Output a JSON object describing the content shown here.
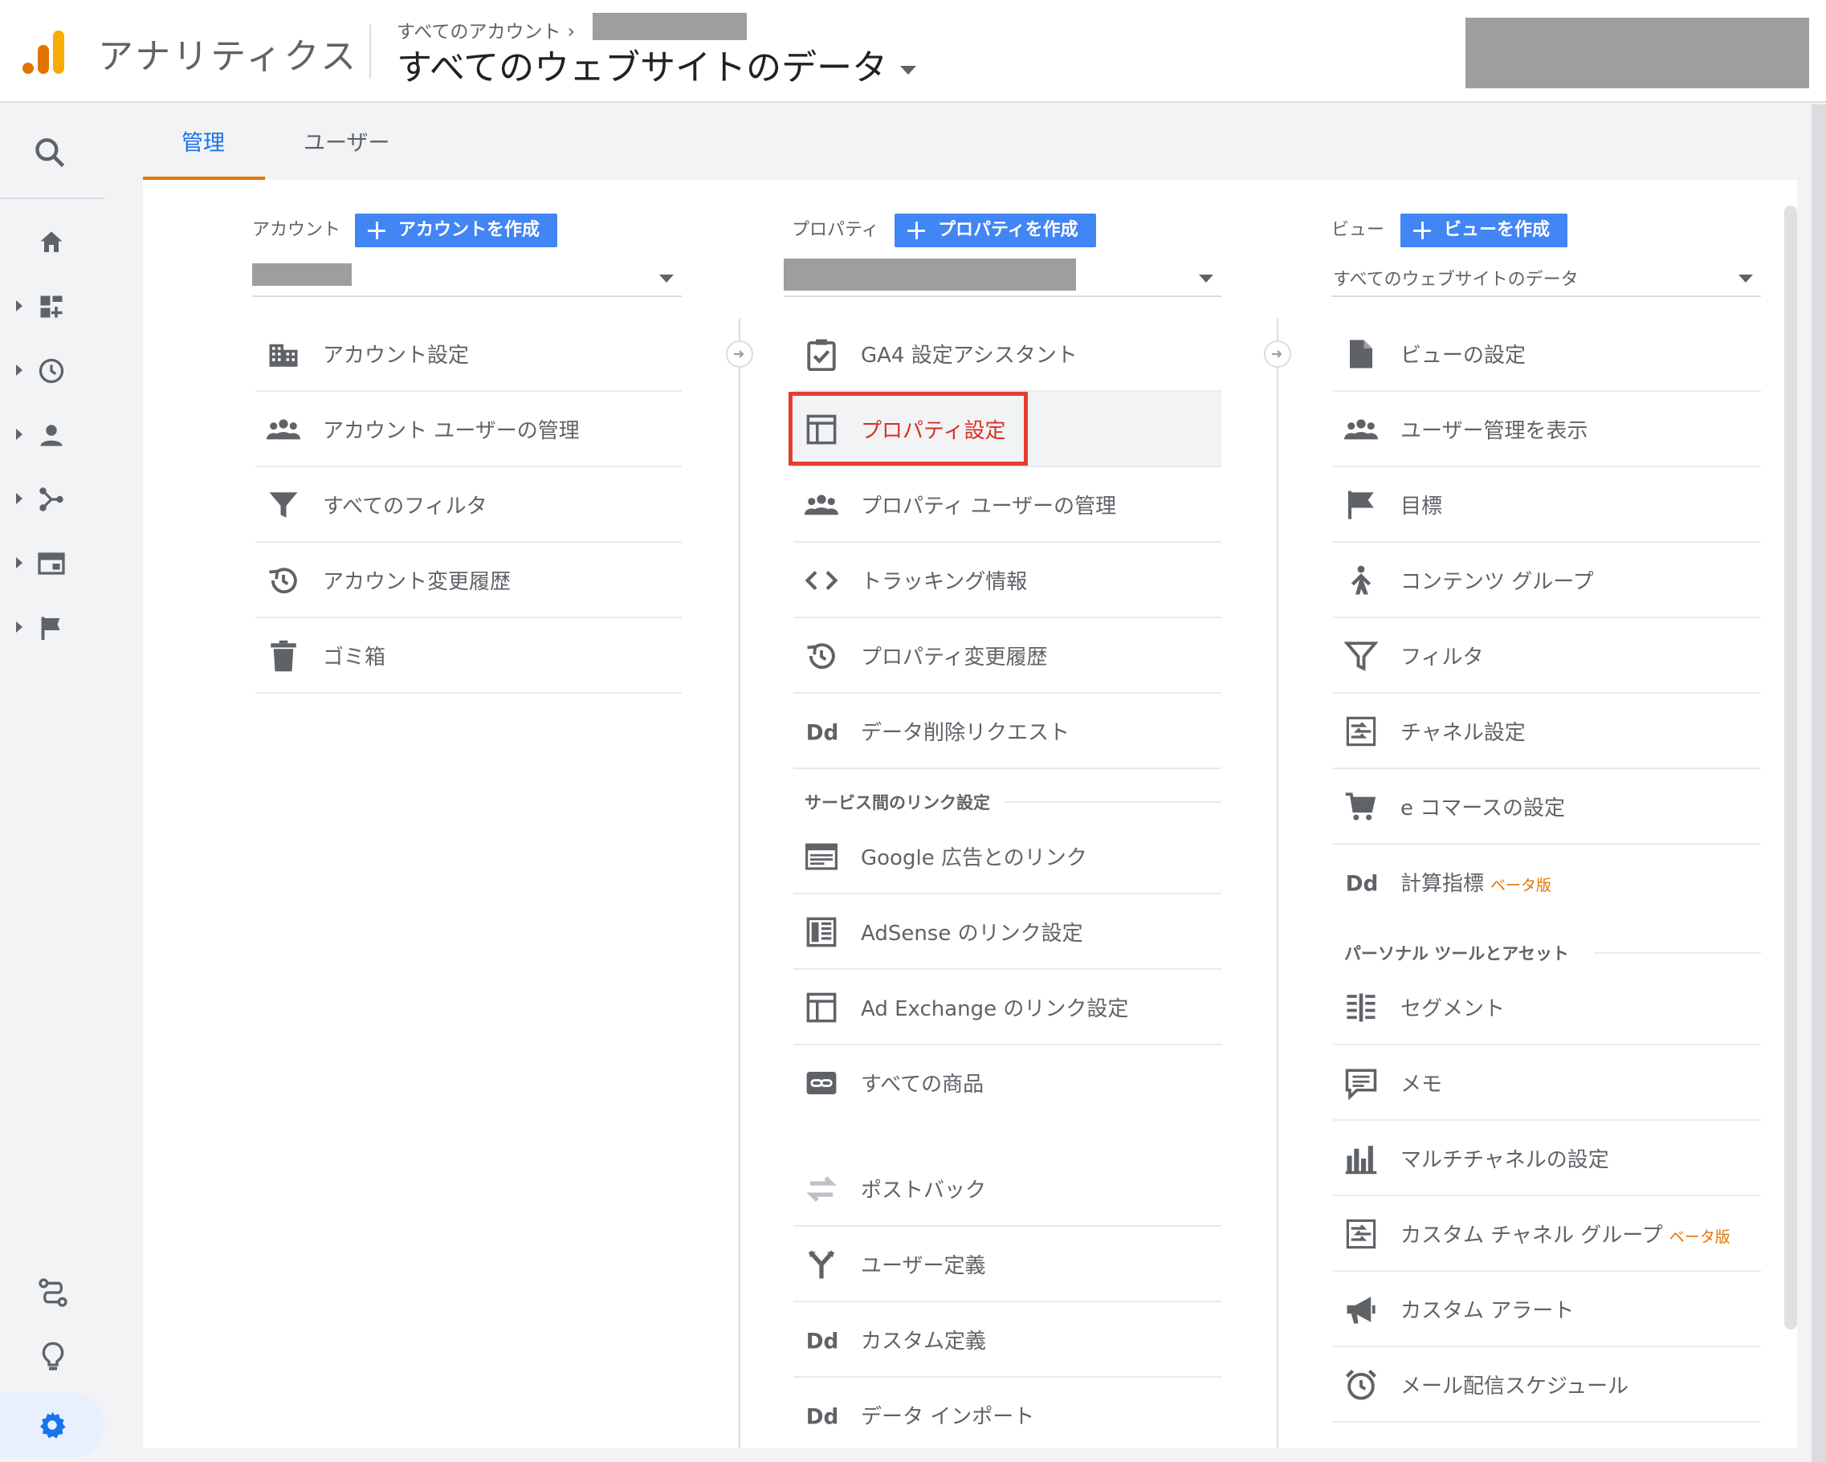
{
  "header": {
    "app_title": "アナリティクス",
    "breadcrumb": "すべてのアカウント",
    "view_title": "すべてのウェブサイトのデータ"
  },
  "tabs": [
    {
      "label": "管理",
      "active": true
    },
    {
      "label": "ユーザー",
      "active": false
    }
  ],
  "nav": {
    "items": [
      "home-icon",
      "customization-icon",
      "realtime-icon",
      "audience-icon",
      "acquisition-icon",
      "behavior-icon",
      "conversions-icon"
    ],
    "bottom": [
      "attribution-icon",
      "discover-icon",
      "admin-gear-icon"
    ]
  },
  "account": {
    "label": "アカウント",
    "create_label": "アカウントを作成",
    "items": [
      {
        "label": "アカウント設定",
        "icon": "building-icon"
      },
      {
        "label": "アカウント ユーザーの管理",
        "icon": "users-icon"
      },
      {
        "label": "すべてのフィルタ",
        "icon": "filter-icon"
      },
      {
        "label": "アカウント変更履歴",
        "icon": "history-icon"
      },
      {
        "label": "ゴミ箱",
        "icon": "trash-icon"
      }
    ]
  },
  "property": {
    "label": "プロパティ",
    "create_label": "プロパティを作成",
    "items": [
      {
        "label": "GA4 設定アシスタント",
        "icon": "checklist-icon"
      },
      {
        "label": "プロパティ設定",
        "icon": "layout-icon",
        "selected": true
      },
      {
        "label": "プロパティ ユーザーの管理",
        "icon": "users-icon"
      },
      {
        "label": "トラッキング情報",
        "icon": "code-icon"
      },
      {
        "label": "プロパティ変更履歴",
        "icon": "history-icon"
      },
      {
        "label": "データ削除リクエスト",
        "icon": "dd-icon"
      }
    ],
    "section_title": "サービス間のリンク設定",
    "link_items": [
      {
        "label": "Google 広告とのリンク",
        "icon": "ads-icon"
      },
      {
        "label": "AdSense のリンク設定",
        "icon": "adsense-icon"
      },
      {
        "label": "Ad Exchange のリンク設定",
        "icon": "layout-icon"
      },
      {
        "label": "すべての商品",
        "icon": "link-icon"
      }
    ],
    "more_items": [
      {
        "label": "ポストバック",
        "icon": "postback-icon"
      },
      {
        "label": "ユーザー定義",
        "icon": "user-definition-icon"
      },
      {
        "label": "カスタム定義",
        "icon": "dd-icon"
      },
      {
        "label": "データ インポート",
        "icon": "dd-icon"
      }
    ]
  },
  "view": {
    "label": "ビュー",
    "create_label": "ビューを作成",
    "selected_view": "すべてのウェブサイトのデータ",
    "items": [
      {
        "label": "ビューの設定",
        "icon": "document-icon"
      },
      {
        "label": "ユーザー管理を表示",
        "icon": "users-icon"
      },
      {
        "label": "目標",
        "icon": "flag-icon"
      },
      {
        "label": "コンテンツ グループ",
        "icon": "person-up-icon"
      },
      {
        "label": "フィルタ",
        "icon": "filter-icon"
      },
      {
        "label": "チャネル設定",
        "icon": "channel-icon"
      },
      {
        "label": "e コマースの設定",
        "icon": "cart-icon"
      },
      {
        "label": "計算指標",
        "icon": "dd-icon",
        "beta": "ベータ版"
      }
    ],
    "section_title": "パーソナル ツールとアセット",
    "personal_items": [
      {
        "label": "セグメント",
        "icon": "segment-icon"
      },
      {
        "label": "メモ",
        "icon": "note-icon"
      },
      {
        "label": "マルチチャネルの設定",
        "icon": "bar-icon"
      },
      {
        "label": "カスタム チャネル グループ",
        "icon": "channel-icon",
        "beta": "ベータ版"
      },
      {
        "label": "カスタム アラート",
        "icon": "megaphone-icon"
      },
      {
        "label": "メール配信スケジュール",
        "icon": "alarm-icon"
      }
    ]
  },
  "colors": {
    "accent_blue": "#4285f4",
    "tab_blue": "#1a73e8",
    "orange": "#e37400",
    "highlight_red": "#e53e2f"
  }
}
